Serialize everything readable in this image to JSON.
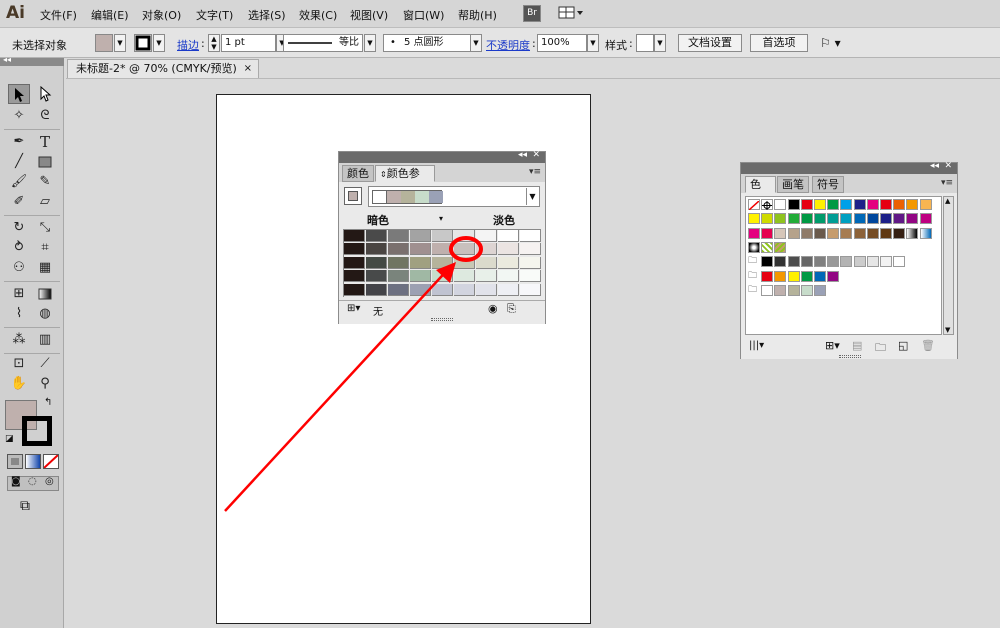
{
  "app": {
    "logo": "Ai"
  },
  "menubar": {
    "items": [
      "文件(F)",
      "编辑(E)",
      "对象(O)",
      "文字(T)",
      "选择(S)",
      "效果(C)",
      "视图(V)",
      "窗口(W)",
      "帮助(H)"
    ],
    "bridge_label": "Br",
    "arrange_icon": "arrange-documents-icon"
  },
  "controlbar": {
    "selection_status": "未选择对象",
    "stroke_label": "描边",
    "stroke_weight": "1 pt",
    "stroke_profile": "等比",
    "brush_label": "5 点圆形",
    "opacity_label": "不透明度",
    "opacity_value": "100%",
    "style_label": "样式",
    "doc_setup_button": "文档设置",
    "preferences_button": "首选项"
  },
  "document": {
    "tab_title": "未标题-2* @ 70% (CMYK/预览)",
    "close_glyph": "×"
  },
  "color_guide_panel": {
    "tabs": [
      "颜色",
      "颜色参考"
    ],
    "active_tab": 1,
    "left_label": "暗色",
    "right_label": "淡色",
    "footer_none_label": "无",
    "harmony_colors": [
      "#ffffff",
      "#bfb0ad",
      "#b5b39b",
      "#c7dcca",
      "#9aa1b6"
    ],
    "grid_columns": [
      [
        "#231815",
        "#231815",
        "#231815",
        "#231815",
        "#231815"
      ],
      [
        "#4a4a4a",
        "#4a4542",
        "#444a44",
        "#484a4a",
        "#444449"
      ],
      [
        "#7a7a7a",
        "#7a706e",
        "#707562",
        "#7a847c",
        "#6d7081"
      ],
      [
        "#a3a3a3",
        "#a09090",
        "#a0a080",
        "#a0b8a4",
        "#9ca0b2"
      ],
      [
        "#c8c8c8",
        "#bfb0ad",
        "#b5b39b",
        "#c7dcca",
        "#c0c3d1"
      ],
      [
        "#e6e6e6",
        "#c8c0bd",
        "#c8c8b5",
        "#dde9df",
        "#d2d4df"
      ],
      [
        "#f4f4f4",
        "#ddd4d2",
        "#dbdacc",
        "#e8f0e9",
        "#e1e2ea"
      ],
      [
        "#ffffff",
        "#ebe4e2",
        "#ebeade",
        "#f2f7f3",
        "#eeeff4"
      ],
      [
        "#ffffff",
        "#f6f2f1",
        "#f5f5ee",
        "#f9fbf9",
        "#f7f7fa"
      ]
    ]
  },
  "swatches_panel": {
    "tabs": [
      "色板",
      "画笔",
      "符号"
    ],
    "active_tab": 0,
    "rows": [
      [
        "none",
        "#ffffff-reg",
        "#ffffff",
        "#000000",
        "#e60012",
        "#fff100",
        "#009944",
        "#00a0e9",
        "#1d2088",
        "#e4007f",
        "#e60012",
        "#eb6100",
        "#f39800",
        "#f8b551"
      ],
      [
        "#fff100",
        "#cfdb00",
        "#8fc31f",
        "#22ac38",
        "#009944",
        "#009b6b",
        "#009e96",
        "#00a0c1",
        "#0068b7",
        "#00479d",
        "#1d2088",
        "#601986",
        "#920783",
        "#be0081"
      ],
      [
        "#e4007f",
        "#e5004f",
        "#d6c6b9",
        "#b5a28b",
        "#8f7b69",
        "#6a5a4c",
        "#c69c6d",
        "#a67c52",
        "#8c6239",
        "#754c24",
        "#603913",
        "#362013",
        "grad",
        "grad2"
      ],
      [
        "circ",
        "pattern",
        "pattern2"
      ],
      [
        "folder",
        "#000000",
        "#333333",
        "#4d4d4d",
        "#666666",
        "#808080",
        "#999999",
        "#b3b3b3",
        "#cccccc",
        "#e6e6e6",
        "#f2f2f2",
        "#ffffff"
      ],
      [
        "folder",
        "#e60012",
        "#f39800",
        "#fff100",
        "#009944",
        "#0068b7",
        "#920783"
      ],
      [
        "folder",
        "#ffffff",
        "#bfb0ad",
        "#b5b39b",
        "#c7dcca",
        "#9aa1b6"
      ]
    ]
  },
  "colors": {
    "fill_swatch": "#bfb0ad",
    "annotation_red": "#ff0000"
  }
}
